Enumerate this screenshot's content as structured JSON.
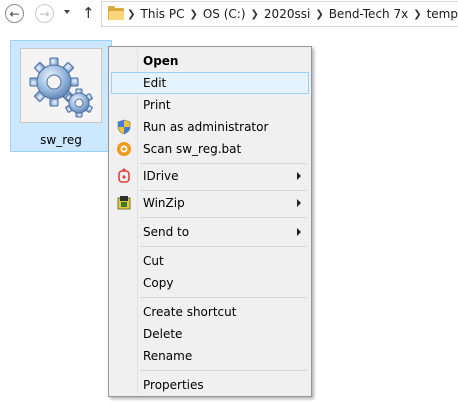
{
  "nav": {
    "back_icon": "arrow-left-icon",
    "forward_icon": "arrow-right-icon",
    "up_icon": "arrow-up-icon",
    "breadcrumb": [
      "This PC",
      "OS (C:)",
      "2020ssi",
      "Bend-Tech 7x",
      "temp"
    ]
  },
  "file": {
    "name": "sw_reg",
    "icon": "gears-icon"
  },
  "menu": {
    "open": "Open",
    "edit": "Edit",
    "print": "Print",
    "run_as_admin": "Run as administrator",
    "scan": "Scan sw_reg.bat",
    "idrive": "IDrive",
    "winzip": "WinZip",
    "send_to": "Send to",
    "cut": "Cut",
    "copy": "Copy",
    "create_shortcut": "Create shortcut",
    "delete": "Delete",
    "rename": "Rename",
    "properties": "Properties"
  },
  "colors": {
    "selection_bg": "#cce8ff",
    "selection_border": "#99d1ff",
    "menu_bg": "#f0f0f0",
    "highlight_bg": "#e5f3ff"
  }
}
